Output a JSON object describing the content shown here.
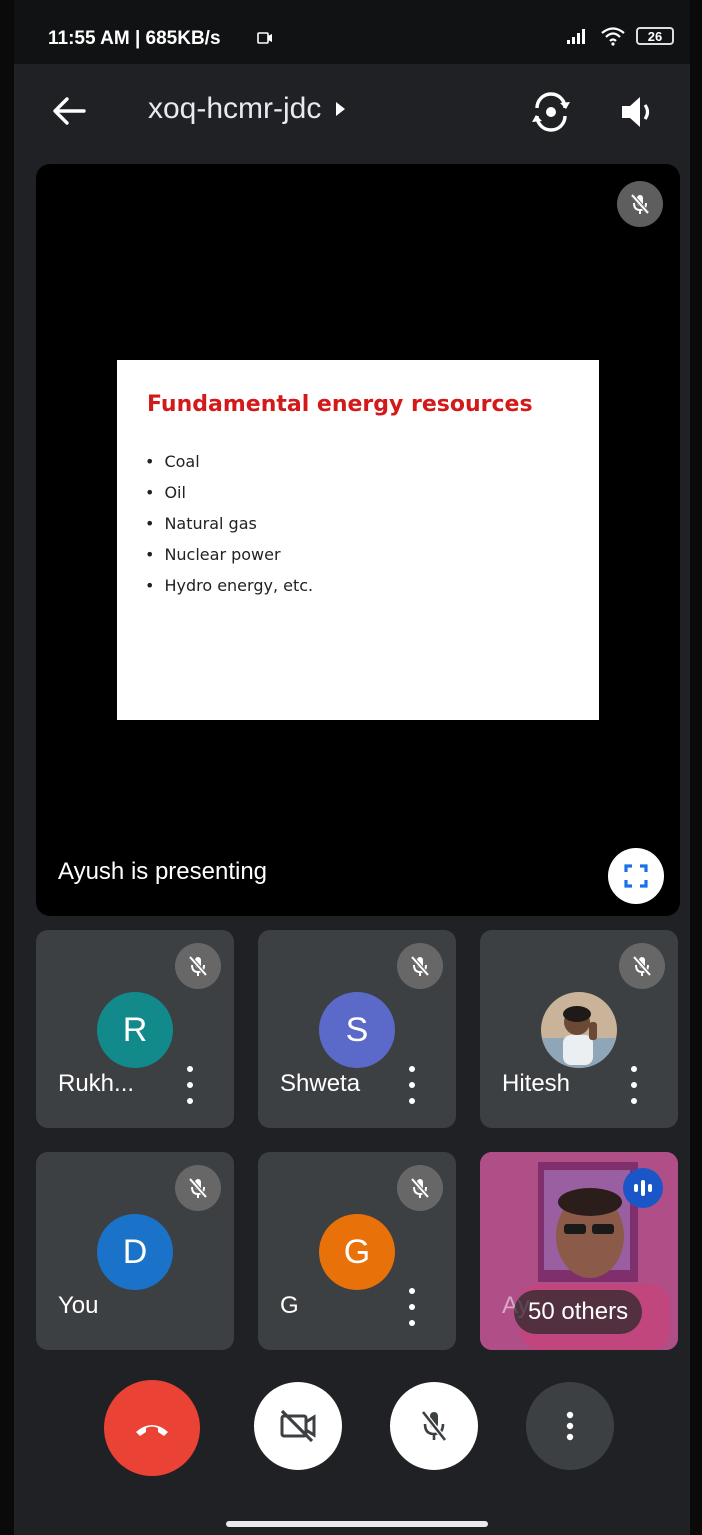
{
  "status_bar": {
    "time": "11:55 AM | 685KB/s",
    "battery": "26"
  },
  "header": {
    "meeting_code": "xoq-hcmr-jdc"
  },
  "presentation": {
    "slide_title": "Fundamental energy resources",
    "slide_bullets": [
      "Coal",
      "Oil",
      "Natural gas",
      "Nuclear power",
      "Hydro energy, etc."
    ],
    "presenting_label": "Ayush is presenting"
  },
  "participants": [
    {
      "name": "Rukh...",
      "initial": "R",
      "color": "#12898b",
      "muted": true
    },
    {
      "name": "Shweta",
      "initial": "S",
      "color": "#5b6ac9",
      "muted": true
    },
    {
      "name": "Hitesh",
      "initial": "",
      "color": "#7a6a5a",
      "muted": true
    },
    {
      "name": "You",
      "initial": "D",
      "color": "#1a73c8",
      "muted": true
    },
    {
      "name": "G",
      "initial": "G",
      "color": "#e8710a",
      "muted": true
    },
    {
      "name": "Ay",
      "others_label": "50 others",
      "speaking": true
    }
  ],
  "colors": {
    "end_call": "#ea4335",
    "speaking_badge": "#1a56c8",
    "slide_title": "#d31a1a"
  }
}
